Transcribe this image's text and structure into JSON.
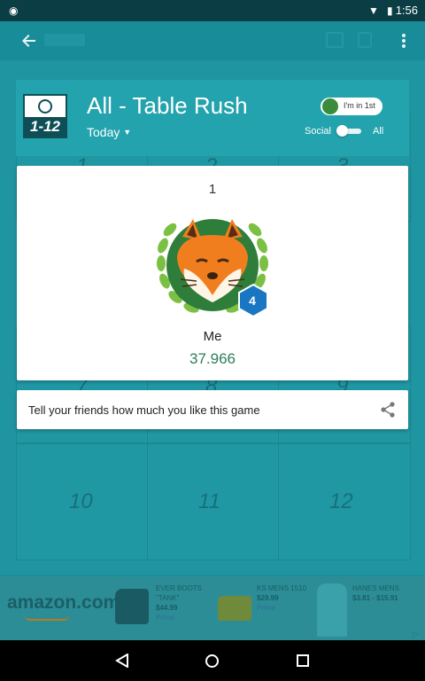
{
  "status_bar": {
    "time": "1:56"
  },
  "header": {
    "logo_text": "1-12",
    "title": "All - Table Rush",
    "time_filter": "Today",
    "rank_badge": "I'm in 1st",
    "toggle_left": "Social",
    "toggle_right": "All"
  },
  "bg_grid": {
    "top_numbers": [
      "1",
      "2",
      "3"
    ],
    "mid_numbers": [
      "7",
      "8",
      "9"
    ],
    "bottom_numbers": [
      "10",
      "11",
      "12"
    ]
  },
  "leaderboard_card": {
    "rank": "1",
    "level": "4",
    "player": "Me",
    "score": "37.966"
  },
  "share_prompt": {
    "text": "Tell your friends how much you like this game"
  },
  "ad": {
    "brand": "amazon.com",
    "items": [
      {
        "name": "EVER BOOTS \"TANK\"",
        "price": "$44.99",
        "cta": "Prime"
      },
      {
        "name": "KS MENS 1510",
        "price": "$29.99",
        "cta": "Prime"
      },
      {
        "name": "HANES MENS",
        "price": "$3.81 - $15.91",
        "cta": ""
      }
    ]
  },
  "colors": {
    "teal": "#1e8f9a",
    "score_green": "#2e7d5b",
    "badge_blue": "#1976c2"
  }
}
